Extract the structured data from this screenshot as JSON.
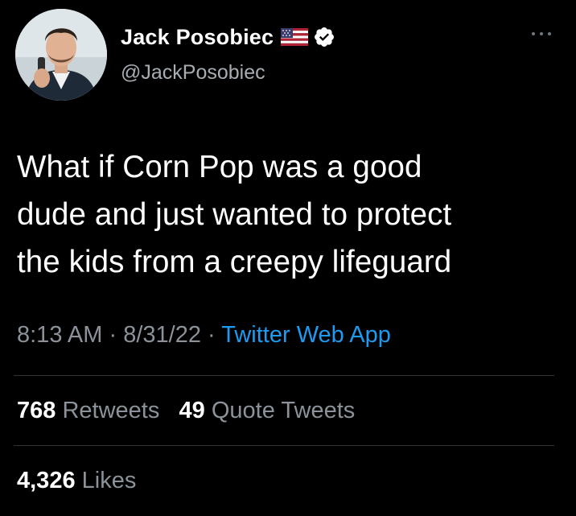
{
  "author": {
    "display_name": "Jack Posobiec",
    "handle": "@JackPosobiec",
    "flag_icon": "us-flag-icon",
    "verified_icon": "verified-badge-icon",
    "verified_color": "#ffffff"
  },
  "more_icon": "more-options-icon",
  "tweet": {
    "lines": [
      "What if Corn Pop was a good",
      "dude and just wanted to protect",
      "the kids from a creepy lifeguard"
    ]
  },
  "meta": {
    "time": "8:13 AM",
    "separator": "·",
    "date": "8/31/22",
    "source": "Twitter Web App"
  },
  "stats": {
    "retweets_count": "768",
    "retweets_label": "Retweets",
    "quotes_count": "49",
    "quotes_label": "Quote Tweets",
    "likes_count": "4,326",
    "likes_label": "Likes"
  },
  "colors": {
    "background": "#000000",
    "text": "#ffffff",
    "secondary": "#8b9299",
    "link": "#1d9bf0",
    "divider": "#2f3336"
  }
}
